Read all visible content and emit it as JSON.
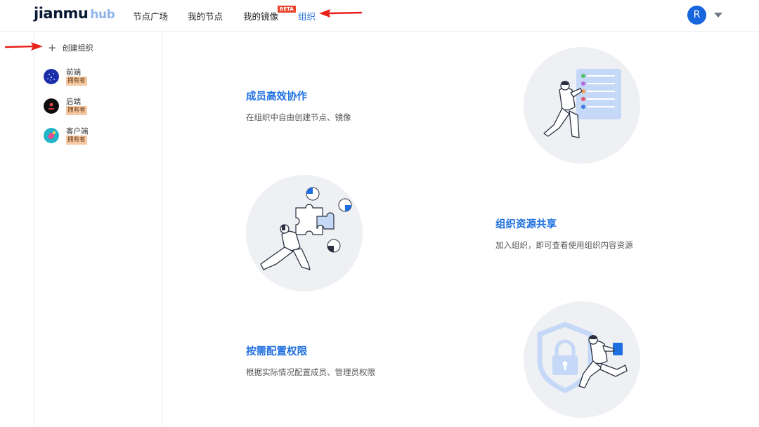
{
  "header": {
    "logo_main": "jianmu",
    "logo_sub": "hub",
    "nav": [
      "节点广场",
      "我的节点",
      "我的镜像",
      "组织"
    ],
    "beta_badge": "BETA",
    "avatar_letter": "R"
  },
  "sidebar": {
    "create_label": "创建组织",
    "orgs": [
      {
        "name": "前端",
        "role": "拥有者"
      },
      {
        "name": "后端",
        "role": "拥有者"
      },
      {
        "name": "客户端",
        "role": "拥有者"
      }
    ]
  },
  "features": [
    {
      "title": "成员高效协作",
      "desc": "在组织中自由创建节点、镜像"
    },
    {
      "title": "组织资源共享",
      "desc": "加入组织，即可查看使用组织内容资源"
    },
    {
      "title": "按需配置权限",
      "desc": "根据实际情况配置成员、管理员权限"
    }
  ],
  "colors": {
    "accent": "#1f6fe0",
    "annotation_arrow": "#e8221b",
    "badge": "#f5c9a4",
    "beta": "#e8452c"
  },
  "icons": [
    "plus-icon",
    "caret-down-icon",
    "annotation-arrow"
  ]
}
